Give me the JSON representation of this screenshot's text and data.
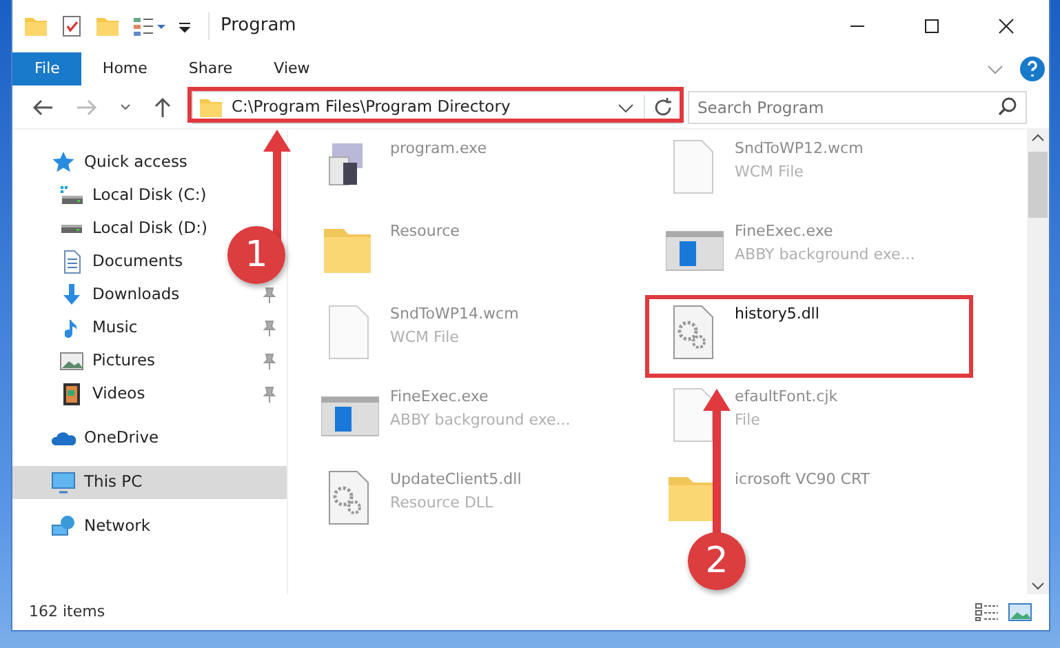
{
  "window": {
    "title": "Program"
  },
  "ribbon_tabs": [
    {
      "label": "File",
      "kind": "file"
    },
    {
      "label": "Home",
      "kind": "tab"
    },
    {
      "label": "Share",
      "kind": "tab"
    },
    {
      "label": "View",
      "kind": "tab"
    }
  ],
  "address_bar": {
    "path": "C:\\Program Files\\Program Directory"
  },
  "search": {
    "placeholder": "Search Program"
  },
  "sidebar": {
    "items": [
      {
        "label": "Quick access",
        "kind": "star",
        "selected": false,
        "children": [
          {
            "label": "Local Disk (C:)",
            "kind": "drive-c",
            "pinned": false
          },
          {
            "label": "Local Disk (D:)",
            "kind": "drive",
            "pinned": false
          },
          {
            "label": "Documents",
            "kind": "document",
            "pinned": false
          },
          {
            "label": "Downloads",
            "kind": "download",
            "pinned": true
          },
          {
            "label": "Music",
            "kind": "music",
            "pinned": true
          },
          {
            "label": "Pictures",
            "kind": "picture",
            "pinned": true
          },
          {
            "label": "Videos",
            "kind": "video",
            "pinned": true
          }
        ]
      },
      {
        "label": "OneDrive",
        "kind": "cloud",
        "selected": false
      },
      {
        "label": "This PC",
        "kind": "pc",
        "selected": true
      },
      {
        "label": "Network",
        "kind": "network",
        "selected": false
      }
    ]
  },
  "files": [
    {
      "name": "program.exe",
      "kind": "exe",
      "highlighted": false
    },
    {
      "name": "SndToWP12.wcm",
      "type": "WCM File",
      "kind": "blank",
      "highlighted": false
    },
    {
      "name": "Resource",
      "kind": "folder",
      "highlighted": false
    },
    {
      "name": "FineExec.exe",
      "type": "ABBY background exe...",
      "kind": "window",
      "highlighted": false
    },
    {
      "name": "SndToWP14.wcm",
      "type": "WCM File",
      "kind": "blank",
      "highlighted": false
    },
    {
      "name": "history5.dll",
      "kind": "gear",
      "highlighted": true
    },
    {
      "name": "FineExec.exe",
      "type": "ABBY background exe...",
      "kind": "window",
      "highlighted": false
    },
    {
      "name": "efaultFont.cjk",
      "type": "File",
      "kind": "blank",
      "highlighted": false
    },
    {
      "name": "UpdateClient5.dll",
      "type": "Resource DLL",
      "kind": "gear",
      "highlighted": false
    },
    {
      "name": "icrosoft VC90 CRT",
      "kind": "folder",
      "highlighted": false
    }
  ],
  "status_bar": {
    "count": "162 items"
  },
  "callouts": [
    {
      "number": "1"
    },
    {
      "number": "2"
    }
  ]
}
